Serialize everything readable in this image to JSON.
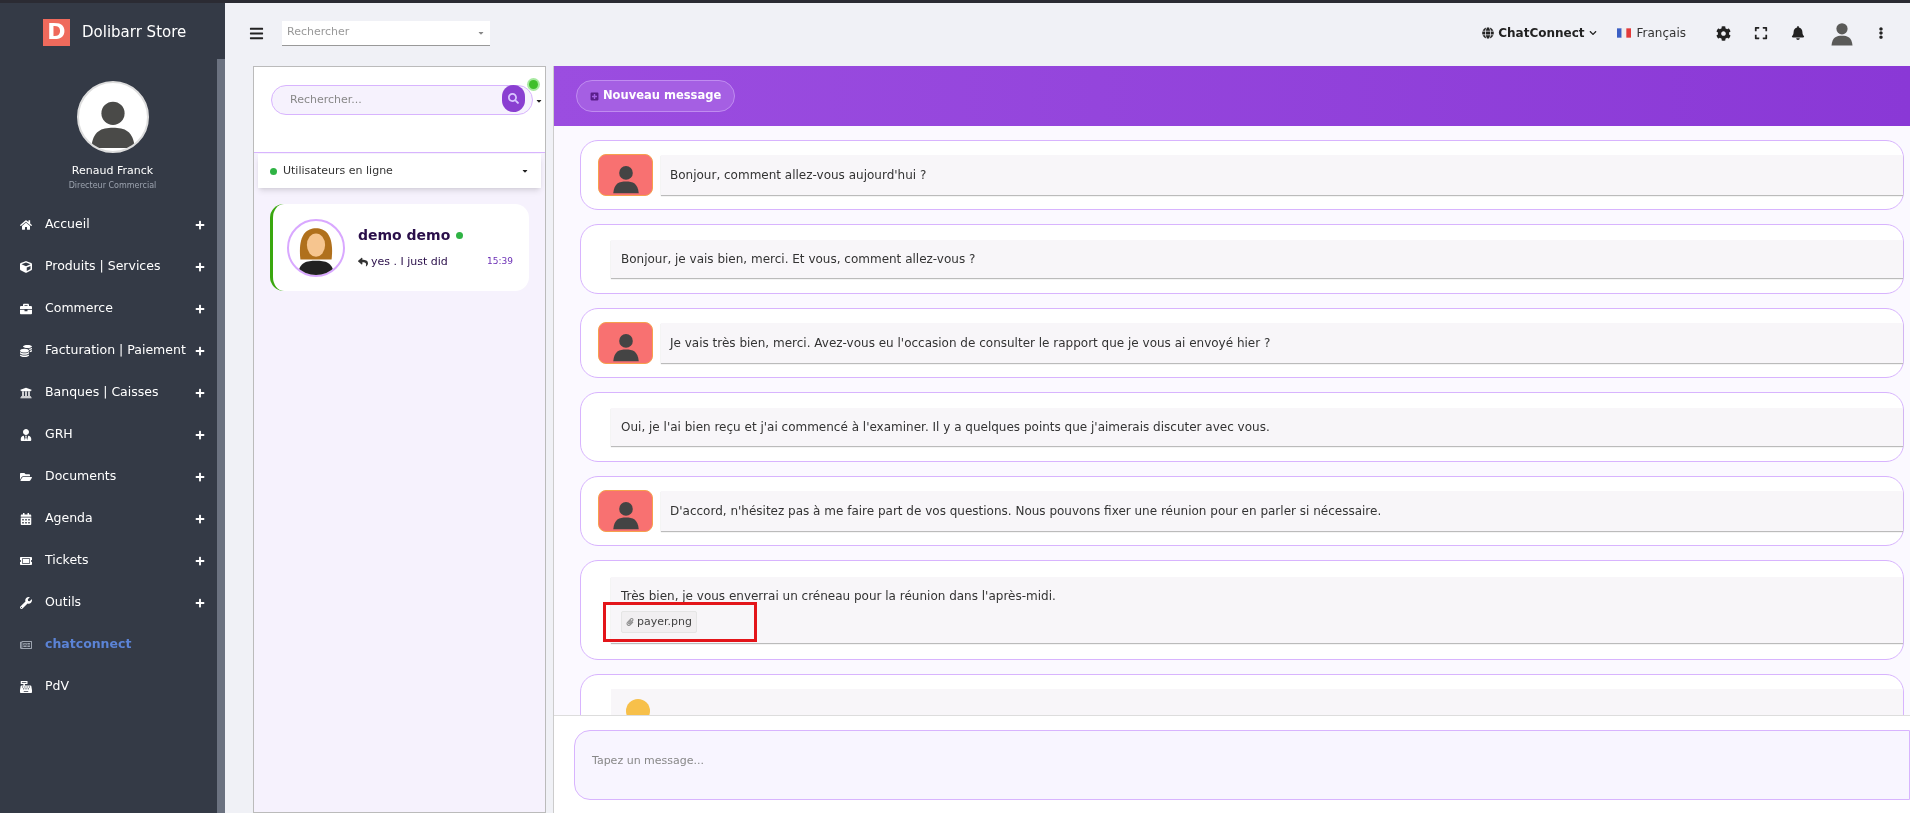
{
  "brand": {
    "letter": "D",
    "name": "Dolibarr Store"
  },
  "profile": {
    "name": "Renaud Franck",
    "role": "Directeur Commercial"
  },
  "menu": [
    {
      "label": "Accueil",
      "expandable": true,
      "selected": false
    },
    {
      "label": "Produits | Services",
      "expandable": true,
      "selected": false
    },
    {
      "label": "Commerce",
      "expandable": true,
      "selected": false
    },
    {
      "label": "Facturation | Paiement",
      "expandable": true,
      "selected": false
    },
    {
      "label": "Banques | Caisses",
      "expandable": true,
      "selected": false
    },
    {
      "label": "GRH",
      "expandable": true,
      "selected": false
    },
    {
      "label": "Documents",
      "expandable": true,
      "selected": false
    },
    {
      "label": "Agenda",
      "expandable": true,
      "selected": false
    },
    {
      "label": "Tickets",
      "expandable": true,
      "selected": false
    },
    {
      "label": "Outils",
      "expandable": true,
      "selected": false
    },
    {
      "label": "chatconnect",
      "expandable": false,
      "selected": true
    },
    {
      "label": "PdV",
      "expandable": false,
      "selected": false
    }
  ],
  "topbar": {
    "search_placeholder": "Rechercher",
    "app_menu": "ChatConnect",
    "language": "Français"
  },
  "contacts_panel": {
    "search_placeholder": "Rechercher...",
    "filter": "Utilisateurs en ligne",
    "contacts": [
      {
        "name": "demo demo",
        "online": true,
        "last_message": "yes . I just did",
        "time": "15:39",
        "selected": true
      }
    ]
  },
  "chat": {
    "new_message_button": "Nouveau message",
    "messages": [
      {
        "kind": "received",
        "text": "Bonjour, comment allez-vous aujourd'hui ?"
      },
      {
        "kind": "sent",
        "text": "Bonjour, je vais bien, merci. Et vous, comment allez-vous ?"
      },
      {
        "kind": "received",
        "text": "Je vais très bien, merci. Avez-vous eu l'occasion de consulter le rapport que je vous ai envoyé hier ?"
      },
      {
        "kind": "sent",
        "text": "Oui, je l'ai bien reçu et j'ai commencé à l'examiner. Il y a quelques points que j'aimerais discuter avec vous."
      },
      {
        "kind": "received",
        "text": "D'accord, n'hésitez pas à me faire part de vos questions. Nous pouvons fixer une réunion pour en parler si nécessaire."
      },
      {
        "kind": "sent",
        "text": "Très bien, je vous enverrai un créneau pour la réunion dans l'après-midi.",
        "attachment": "payer.png",
        "highlighted": true
      },
      {
        "kind": "emoji"
      }
    ],
    "input_placeholder": "Tapez un message..."
  }
}
